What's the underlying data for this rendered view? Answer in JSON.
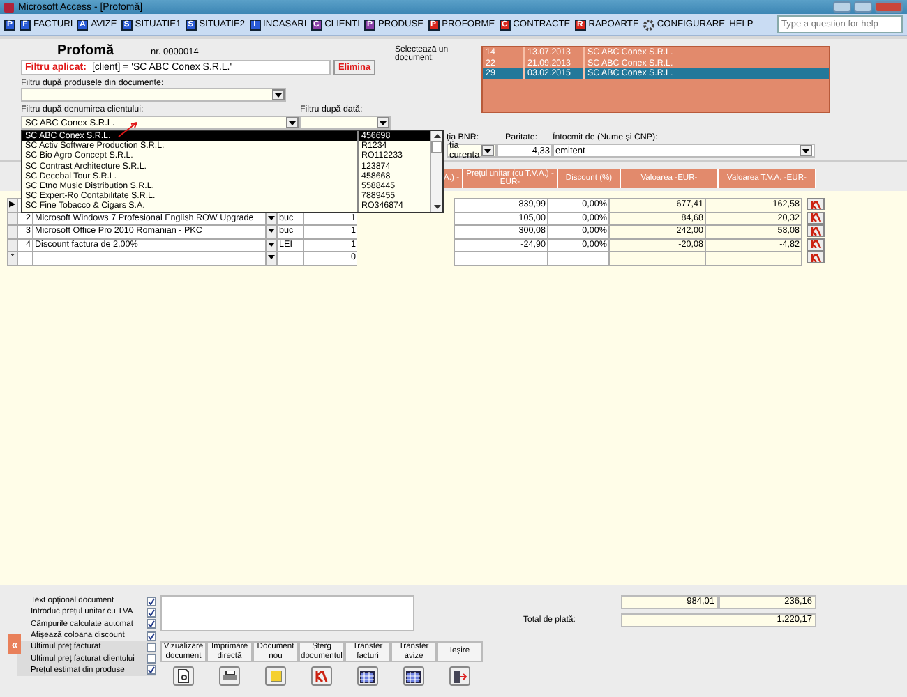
{
  "window": {
    "title": "Microsoft Access - [Profomă]"
  },
  "menu": [
    {
      "kind": "letter",
      "icon": "P",
      "color": "#2a5bd7"
    },
    {
      "kind": "letter",
      "icon": "F",
      "label": "FACTURI",
      "color": "#2a5bd7"
    },
    {
      "kind": "letter",
      "icon": "A",
      "label": "AVIZE",
      "color": "#2a5bd7"
    },
    {
      "kind": "letter",
      "icon": "S",
      "label": "SITUATIE1",
      "color": "#2a5bd7"
    },
    {
      "kind": "letter",
      "icon": "S",
      "label": "SITUATIE2",
      "color": "#2a5bd7"
    },
    {
      "kind": "letter",
      "icon": "I",
      "label": "INCASARI",
      "color": "#2a5bd7"
    },
    {
      "kind": "letter",
      "icon": "C",
      "label": "CLIENTI",
      "color": "#8a3fa8"
    },
    {
      "kind": "letter",
      "icon": "P",
      "label": "PRODUSE",
      "color": "#8a3fa8"
    },
    {
      "kind": "letter",
      "icon": "P",
      "label": "PROFORME",
      "color": "#d8261c"
    },
    {
      "kind": "letter",
      "icon": "C",
      "label": "CONTRACTE",
      "color": "#d8261c"
    },
    {
      "kind": "letter",
      "icon": "R",
      "label": "RAPOARTE",
      "color": "#d8261c"
    },
    {
      "kind": "gear",
      "label": "CONFIGURARE"
    },
    {
      "kind": "text",
      "label": "HELP"
    }
  ],
  "help_search": {
    "placeholder": "Type a question for help"
  },
  "form": {
    "title": "Profomă",
    "number": "nr. 0000014",
    "filter_applied": {
      "label": "Filtru aplicat:",
      "value": "[client] = 'SC ABC Conex S.R.L.'",
      "button": "Elimina"
    },
    "product_filter": {
      "label": "Filtru după produsele din documente:"
    },
    "client_filter": {
      "label": "Filtru după denumirea clientului:",
      "value": "SC ABC Conex S.R.L."
    },
    "date_filter": {
      "label": "Filtru după dată:"
    },
    "documents": {
      "label": "Selectează un document:",
      "rows": [
        {
          "nr": "14",
          "date": "13.07.2013",
          "client": "SC ABC Conex S.R.L.",
          "selected": false
        },
        {
          "nr": "22",
          "date": "21.09.2013",
          "client": "SC ABC Conex S.R.L.",
          "selected": false
        },
        {
          "nr": "29",
          "date": "03.02.2015",
          "client": "SC ABC Conex S.R.L.",
          "selected": true
        }
      ]
    },
    "rate": {
      "label": "ția BNR:",
      "value": "ția curenta"
    },
    "parity": {
      "label": "Paritate:",
      "value": "4,33"
    },
    "issued_by": {
      "label": "Întocmit de (Nume și CNP):",
      "value": "emitent"
    }
  },
  "client_dropdown": [
    {
      "name": "SC ABC Conex S.R.L.",
      "code": "456698",
      "selected": true
    },
    {
      "name": "SC Activ Software Production S.R.L.",
      "code": "R1234",
      "selected": false
    },
    {
      "name": "SC Bio Agro Concept S.R.L.",
      "code": "RO112233",
      "selected": false
    },
    {
      "name": "SC Contrast Architecture S.R.L.",
      "code": "123874",
      "selected": false
    },
    {
      "name": "SC Decebal Tour S.R.L.",
      "code": "458668",
      "selected": false
    },
    {
      "name": "SC Etno Music Distribution S.R.L.",
      "code": "5588445",
      "selected": false
    },
    {
      "name": "SC Expert-Ro Contabilitate S.R.L.",
      "code": "7889455",
      "selected": false
    },
    {
      "name": "SC Fine Tobacco & Cigars S.A.",
      "code": "RO346874",
      "selected": false
    }
  ],
  "table": {
    "columns": [
      "A.) -",
      "Prețul unitar (cu T.V.A.) -EUR-",
      "Discount (%)",
      "Valoarea -EUR-",
      "Valoarea T.V.A. -EUR-"
    ],
    "rows": [
      {
        "selector": "▶",
        "price": "839,99",
        "discount": "0,00%",
        "value": "677,41",
        "vat": "162,58"
      },
      {
        "nr": "2",
        "name": "Microsoft Windows 7 Profesional English ROW Upgrade",
        "unit": "buc",
        "qty": "1",
        "price": "105,00",
        "discount": "0,00%",
        "value": "84,68",
        "vat": "20,32"
      },
      {
        "nr": "3",
        "name": "Microsoft Office Pro 2010 Romanian - PKC",
        "unit": "buc",
        "qty": "1",
        "price": "300,08",
        "discount": "0,00%",
        "value": "242,00",
        "vat": "58,08"
      },
      {
        "nr": "4",
        "name": "Discount factura de 2,00%",
        "unit": "LEI",
        "qty": "1",
        "price": "-24,90",
        "discount": "0,00%",
        "value": "-20,08",
        "vat": "-4,82"
      },
      {
        "selector": "*",
        "qty": "0"
      }
    ]
  },
  "options": [
    {
      "label": "Text opțional document",
      "checked": true
    },
    {
      "label": "Introduc prețul unitar cu TVA",
      "checked": true
    },
    {
      "label": "Câmpurile calculate automat",
      "checked": true
    },
    {
      "label": "Afișează coloana discount",
      "checked": true
    },
    {
      "label": "Ultimul preț facturat",
      "checked": false
    },
    {
      "label": "Ultimul preț facturat clientului",
      "checked": false
    },
    {
      "label": "Prețul estimat din produse",
      "checked": true
    }
  ],
  "collapse_button": "«",
  "actions": [
    {
      "kind": "preview",
      "label": "Vizualizare document"
    },
    {
      "kind": "print",
      "label": "Imprimare directă"
    },
    {
      "kind": "new",
      "label": "Document nou"
    },
    {
      "kind": "delete",
      "label": "Șterg documentul"
    },
    {
      "kind": "transfer",
      "label": "Transfer facturi"
    },
    {
      "kind": "transfer",
      "label": "Transfer avize"
    },
    {
      "kind": "exit",
      "label": "Ieșire"
    }
  ],
  "totals": {
    "value": "984,01",
    "vat": "236,16",
    "label": "Total de plată:",
    "total": "1.220,17"
  }
}
